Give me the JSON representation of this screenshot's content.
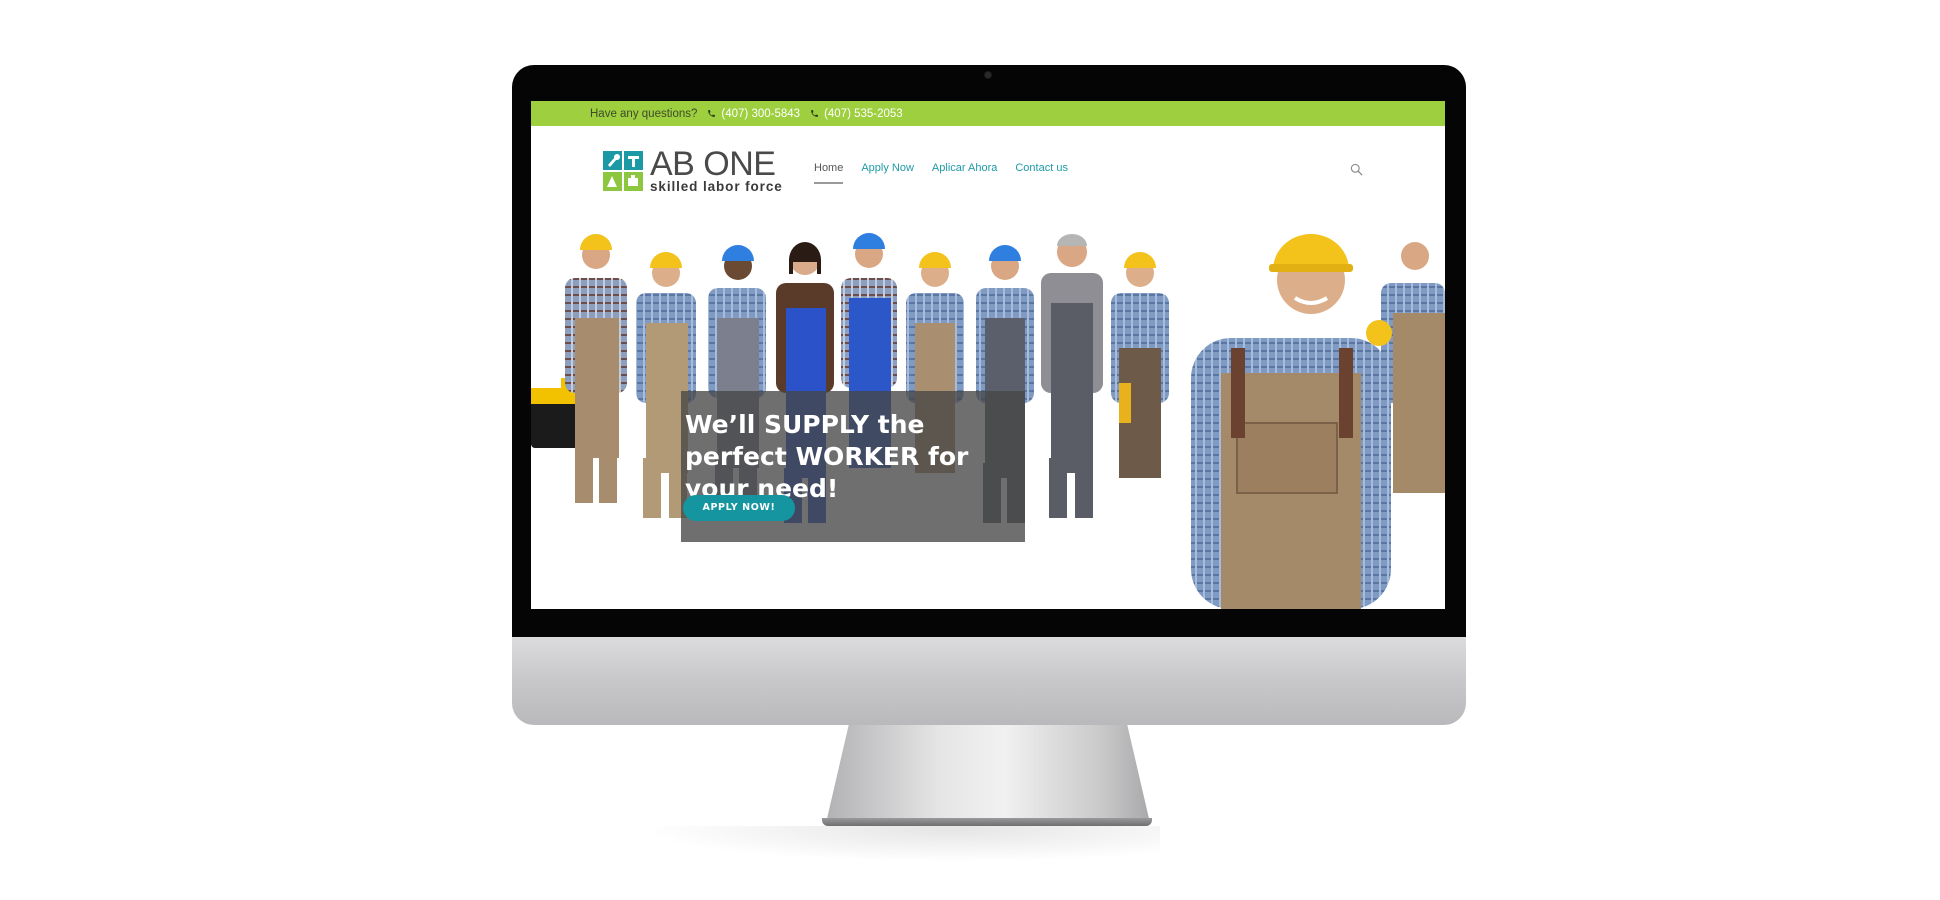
{
  "topbar": {
    "question": "Have any questions?",
    "phones": [
      "(407) 300-5843",
      "(407) 535-2053"
    ]
  },
  "logo": {
    "title": "AB ONE",
    "tagline": "skilled labor force"
  },
  "nav": {
    "items": [
      "Home",
      "Apply Now",
      "Aplicar Ahora",
      "Contact us"
    ],
    "active": "Home"
  },
  "hero": {
    "heading": "We’ll SUPPLY the perfect WORKER for your need!",
    "button": "APPLY NOW!"
  },
  "icons": {
    "phone": "phone-icon",
    "search": "search-icon"
  },
  "colors": {
    "topbar": "#9dcf3f",
    "accent": "#15959f",
    "link": "#1e9aa6"
  }
}
